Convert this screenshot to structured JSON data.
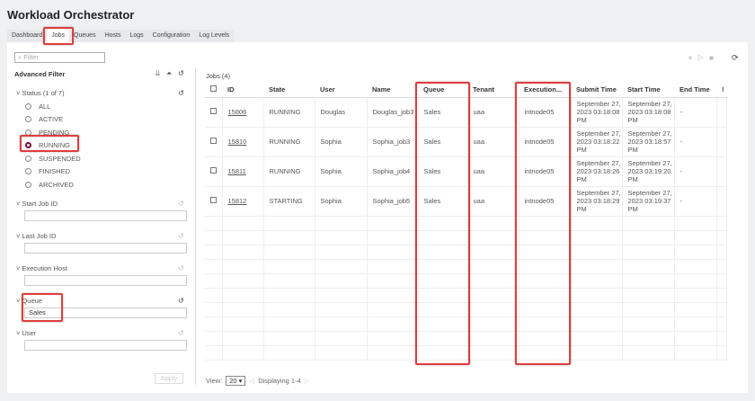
{
  "app_title": "Workload Orchestrator",
  "tabs": [
    "Dashboard",
    "Jobs",
    "Queues",
    "Hosts",
    "Logs",
    "Configuration",
    "Log Levels"
  ],
  "filter_placeholder": "Filter",
  "advanced_filter": "Advanced Filter",
  "status": {
    "label": "Status (1 of 7)",
    "options": [
      "ALL",
      "ACTIVE",
      "PENDING",
      "RUNNING",
      "SUSPENDED",
      "FINISHED",
      "ARCHIVED"
    ],
    "selected": "RUNNING"
  },
  "fields": [
    {
      "label": "Start Job ID",
      "value": ""
    },
    {
      "label": "Last Job ID",
      "value": ""
    },
    {
      "label": "Execution Host",
      "value": ""
    },
    {
      "label": "Queue",
      "value": "Sales"
    },
    {
      "label": "User",
      "value": ""
    }
  ],
  "apply": "Apply",
  "jobs_count": "Jobs (4)",
  "columns": [
    "ID",
    "State",
    "User",
    "Name",
    "Queue",
    "Tenant",
    "Execution...",
    "Submit Time",
    "Start Time",
    "End Time",
    "!"
  ],
  "rows": [
    [
      "15806",
      "RUNNING",
      "Douglas",
      "Douglas_job3",
      "Sales",
      "uaa",
      "intnode05",
      "September 27, 2023 03:18:08 PM",
      "September 27, 2023 03:18:08 PM",
      "-"
    ],
    [
      "15810",
      "RUNNING",
      "Sophia",
      "Sophia_job3",
      "Sales",
      "uaa",
      "intnode05",
      "September 27, 2023 03:18:22 PM",
      "September 27, 2023 03:18:57 PM",
      "-"
    ],
    [
      "15811",
      "RUNNING",
      "Sophia",
      "Sophia_job4",
      "Sales",
      "uaa",
      "intnode05",
      "September 27, 2023 03:18:26 PM",
      "September 27, 2023 03:19:20 PM",
      "-"
    ],
    [
      "15812",
      "STARTING",
      "Sophia",
      "Sophia_job5",
      "Sales",
      "uaa",
      "intnode05",
      "September 27, 2023 03:18:29 PM",
      "September 27, 2023 03:19:37 PM",
      "-"
    ]
  ],
  "footer": {
    "view_label": "View:",
    "page_size": "20",
    "displaying": "Displaying 1-4"
  }
}
